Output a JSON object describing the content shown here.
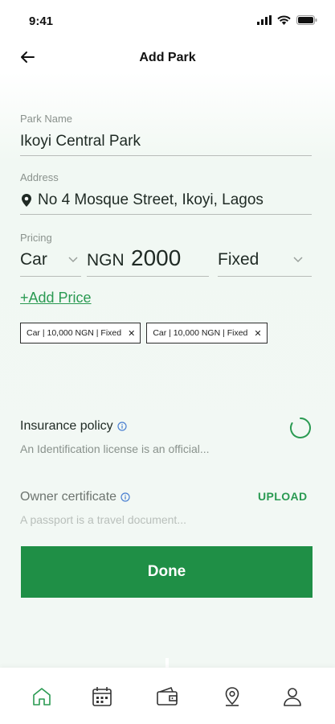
{
  "status_bar": {
    "time": "9:41"
  },
  "header": {
    "title": "Add Park"
  },
  "form": {
    "park_name": {
      "label": "Park Name",
      "value": "Ikoyi Central Park"
    },
    "address": {
      "label": "Address",
      "value": "No 4 Mosque Street, Ikoyi, Lagos"
    },
    "pricing": {
      "label": "Pricing",
      "vehicle": "Car",
      "currency": "NGN",
      "amount": "2000",
      "type": "Fixed"
    },
    "add_price_label": "+Add Price",
    "price_chips": [
      {
        "label": "Car | 10,000 NGN | Fixed",
        "remove": "✕"
      },
      {
        "label": "Car | 10,000 NGN | Fixed",
        "remove": "✕"
      }
    ]
  },
  "documents": {
    "insurance": {
      "title": "Insurance policy",
      "subtitle": "An Identification license is an official..."
    },
    "owner_certificate": {
      "title": "Owner certificate",
      "subtitle": "A passport is a travel document...",
      "action": "UPLOAD"
    }
  },
  "done_label": "Done",
  "colors": {
    "accent": "#1f8f46",
    "link": "#2a9a52",
    "background_tint": "#f2f8f4"
  },
  "bottom_nav": [
    "home-icon",
    "calendar-icon",
    "wallet-icon",
    "location-pin-icon",
    "profile-icon"
  ]
}
